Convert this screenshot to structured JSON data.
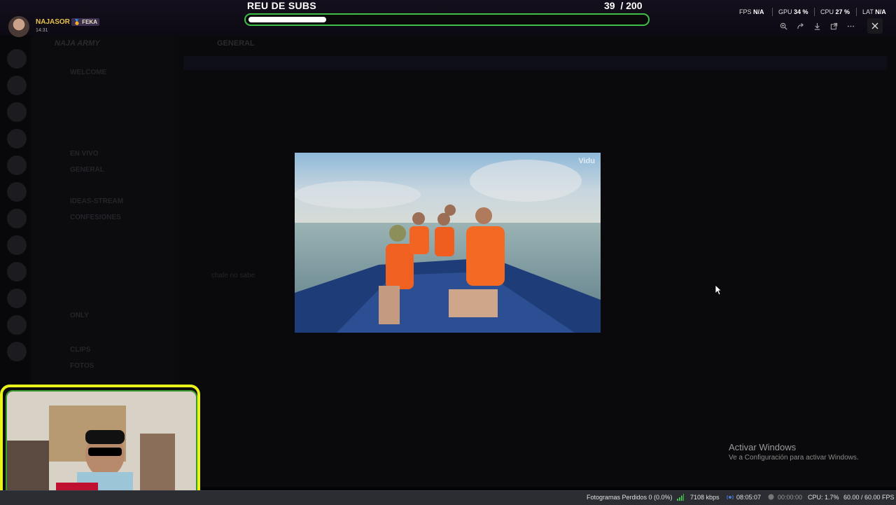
{
  "overlay": {
    "user": {
      "name": "NAJASOR",
      "badge": "FEKA",
      "time": "14:31"
    },
    "subs_goal": {
      "title": "REU DE SUBS",
      "current": "39",
      "separator": "/",
      "goal": "200",
      "progress": 0.195
    },
    "perf": {
      "fps_label": "FPS",
      "fps_value": "N/A",
      "gpu_label": "GPU",
      "gpu_value": "34 %",
      "cpu_label": "CPU",
      "cpu_value": "27 %",
      "lat_label": "LAT",
      "lat_value": "N/A"
    }
  },
  "discord": {
    "server_name": "NAJA ARMY",
    "channels": [
      "WELCOME",
      "EN VIVO",
      "GENERAL",
      "IDEAS-STREAM",
      "CONFESIONES",
      "ONLY",
      "CLIPS",
      "FOTOS"
    ],
    "chat_header": "GENERAL",
    "messages": [
      "chale no sabe"
    ]
  },
  "image_viewer": {
    "watermark": "Vidu",
    "toolbar_icons": [
      "zoom-in-icon",
      "forward-icon",
      "download-icon",
      "open-external-icon",
      "more-icon"
    ],
    "close_icon": "close-icon"
  },
  "windows_watermark": {
    "title": "Activar Windows",
    "subtitle": "Ve a Configuración para activar Windows."
  },
  "status_bar": {
    "dropped_frames": "Fotogramas Perdidos 0 (0.0%)",
    "bitrate": "7108 kbps",
    "stream_time": "08:05:07",
    "record_time": "00:00:00",
    "cpu": "CPU: 1.7%",
    "fps": "60.00 / 60.00 FPS"
  },
  "colors": {
    "accent_green": "#3fbf4a",
    "webcam_border": "#e9f21b",
    "username": "#e8c34a"
  }
}
